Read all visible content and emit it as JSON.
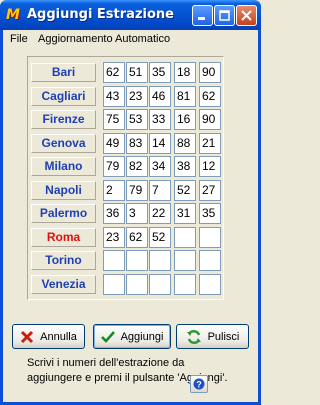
{
  "window": {
    "title": "Aggiungi Estrazione",
    "app_icon_text": "M"
  },
  "menu": [
    "File",
    "Aggiornamento Automatico"
  ],
  "rows": [
    {
      "city": "Bari",
      "numbers": [
        "62",
        "51",
        "35",
        "18",
        "90"
      ]
    },
    {
      "city": "Cagliari",
      "numbers": [
        "43",
        "23",
        "46",
        "81",
        "62"
      ]
    },
    {
      "city": "Firenze",
      "numbers": [
        "75",
        "53",
        "33",
        "16",
        "90"
      ]
    },
    {
      "city": "Genova",
      "numbers": [
        "49",
        "83",
        "14",
        "88",
        "21"
      ]
    },
    {
      "city": "Milano",
      "numbers": [
        "79",
        "82",
        "34",
        "38",
        "12"
      ]
    },
    {
      "city": "Napoli",
      "numbers": [
        "2",
        "79",
        "7",
        "52",
        "27"
      ]
    },
    {
      "city": "Palermo",
      "numbers": [
        "36",
        "3",
        "22",
        "31",
        "35"
      ]
    },
    {
      "city": "Roma",
      "numbers": [
        "23",
        "62",
        "52",
        "",
        ""
      ],
      "active": true
    },
    {
      "city": "Torino",
      "numbers": [
        "",
        "",
        "",
        "",
        ""
      ]
    },
    {
      "city": "Venezia",
      "numbers": [
        "",
        "",
        "",
        "",
        ""
      ]
    }
  ],
  "buttons": {
    "cancel": "Annulla",
    "add": "Aggiungi",
    "clear": "Pulisci"
  },
  "status_text": "Scrivi i numeri dell'estrazione da aggiungere e premi il pulsante 'Aggiungi'.",
  "colors": {
    "city_text": "#1F3FB5",
    "active_city_text": "#E01010",
    "titlebar": "#0553D4"
  },
  "icons": {
    "cancel": "x-icon",
    "add": "check-icon",
    "clear": "refresh-icon",
    "help": "question-icon"
  }
}
